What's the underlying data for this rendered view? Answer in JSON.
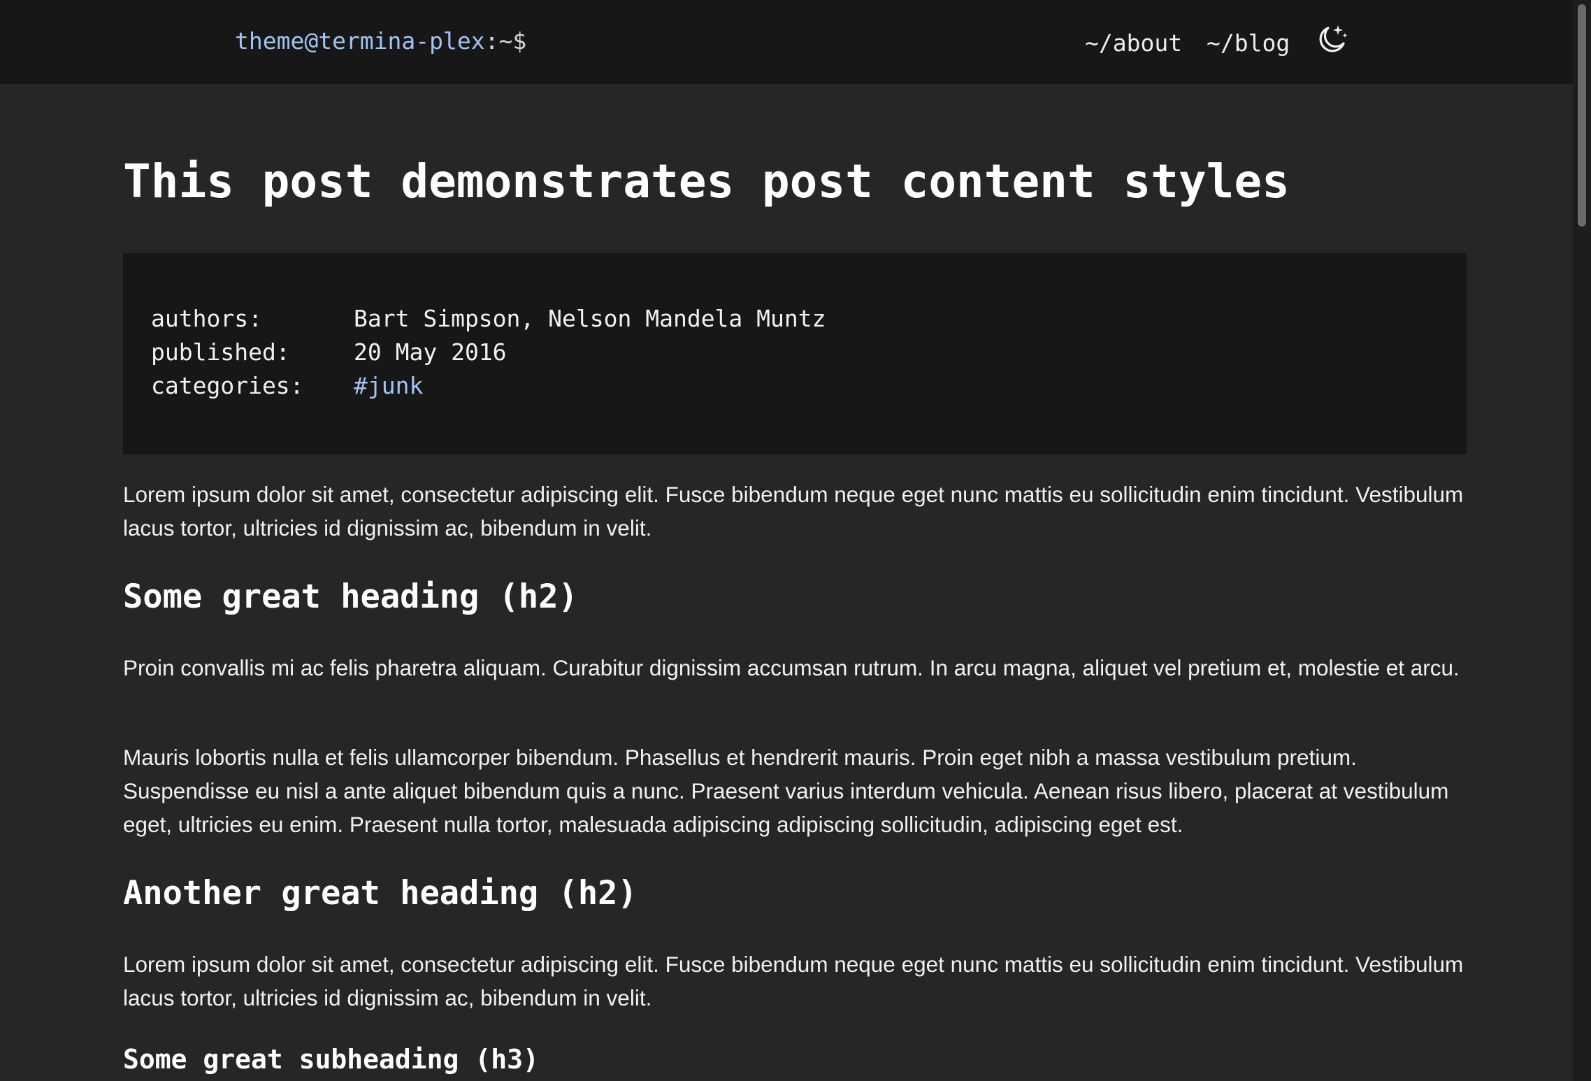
{
  "header": {
    "brand_user": "theme@termina-plex",
    "brand_suffix": ":~$",
    "nav": {
      "about": "~/about",
      "blog": "~/blog"
    },
    "theme_toggle_icon": "moon-stars-icon"
  },
  "post": {
    "title": "This post demonstrates post content styles",
    "meta": {
      "authors_label": "authors:",
      "authors_value": "Bart Simpson, Nelson Mandela Muntz",
      "published_label": "published:",
      "published_value": "20 May 2016",
      "categories_label": "categories:",
      "categories_value": "#junk"
    },
    "paragraphs": [
      "Lorem ipsum dolor sit amet, consectetur adipiscing elit. Fusce bibendum neque eget nunc mattis eu sollicitudin enim tincidunt. Vestibulum lacus tortor, ultricies id dignissim ac, bibendum in velit.",
      "Proin convallis mi ac felis pharetra aliquam. Curabitur dignissim accumsan rutrum. In arcu magna, aliquet vel pretium et, molestie et arcu.",
      "Mauris lobortis nulla et felis ullamcorper bibendum. Phasellus et hendrerit mauris. Proin eget nibh a massa vestibulum pretium. Suspendisse eu nisl a ante aliquet bibendum quis a nunc. Praesent varius interdum vehicula. Aenean risus libero, placerat at vestibulum eget, ultricies eu enim. Praesent nulla tortor, malesuada adipiscing adipiscing sollicitudin, adipiscing eget est.",
      "Lorem ipsum dolor sit amet, consectetur adipiscing elit. Fusce bibendum neque eget nunc mattis eu sollicitudin enim tincidunt. Vestibulum lacus tortor, ultricies id dignissim ac, bibendum in velit."
    ],
    "headings": {
      "h2_first": "Some great heading (h2)",
      "h2_second": "Another great heading (h2)",
      "h3_first": "Some great subheading (h3)"
    }
  },
  "colors": {
    "page_bg": "#262626",
    "bar_bg": "#171717",
    "accent": "#a3c4f3",
    "text": "#f1f1f1"
  }
}
